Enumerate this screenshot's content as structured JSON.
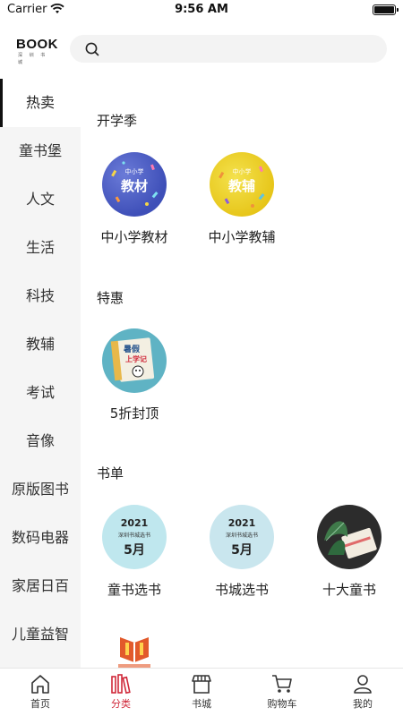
{
  "status_bar": {
    "carrier": "Carrier",
    "time": "9:56 AM"
  },
  "header": {
    "logo_text": "BOOK",
    "logo_sub": "深 圳 书 城",
    "search_icon": "search-icon"
  },
  "sidebar": {
    "items": [
      {
        "label": "热卖",
        "active": true
      },
      {
        "label": "童书堡"
      },
      {
        "label": "人文"
      },
      {
        "label": "生活"
      },
      {
        "label": "科技"
      },
      {
        "label": "教辅"
      },
      {
        "label": "考试"
      },
      {
        "label": "音像"
      },
      {
        "label": "原版图书"
      },
      {
        "label": "数码电器"
      },
      {
        "label": "家居日百"
      },
      {
        "label": "儿童益智"
      }
    ]
  },
  "main": {
    "sections": [
      {
        "title": "开学季",
        "items": [
          {
            "label": "中小学教材",
            "img_small": "中小学",
            "img_big": "教材"
          },
          {
            "label": "中小学教辅",
            "img_small": "中小学",
            "img_big": "教辅"
          }
        ]
      },
      {
        "title": "特惠",
        "items": [
          {
            "label": "5折封顶"
          }
        ]
      },
      {
        "title": "书单",
        "items": [
          {
            "label": "童书选书",
            "img_year": "2021",
            "img_shop": "深圳书城选书",
            "img_month": "5月"
          },
          {
            "label": "书城选书",
            "img_year": "2021",
            "img_shop": "深圳书城选书",
            "img_month": "5月"
          },
          {
            "label": "十大童书"
          }
        ]
      }
    ]
  },
  "tabbar": {
    "items": [
      {
        "label": "首页",
        "icon": "home-icon"
      },
      {
        "label": "分类",
        "icon": "category-icon",
        "active": true
      },
      {
        "label": "书城",
        "icon": "store-icon"
      },
      {
        "label": "购物车",
        "icon": "cart-icon"
      },
      {
        "label": "我的",
        "icon": "profile-icon"
      }
    ]
  },
  "colors": {
    "accent": "#d0293a",
    "sidebar_bg": "#f5f5f5",
    "search_bg": "#f3f3f3"
  }
}
